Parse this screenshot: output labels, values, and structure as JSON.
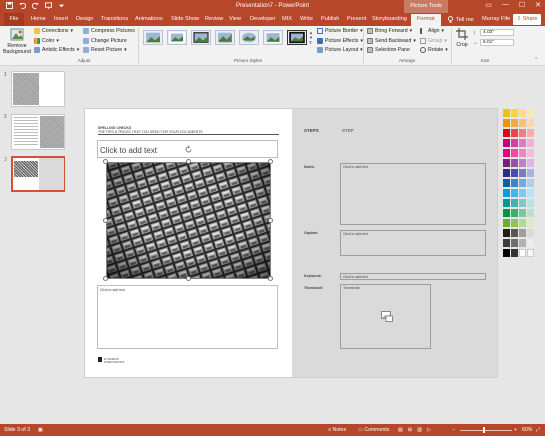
{
  "titlebar": {
    "title": "Presentation7 - PowerPoint",
    "context_tab": "Picture Tools",
    "minimize": "—",
    "maximize": "☐",
    "close": "✕"
  },
  "tabs": [
    {
      "label": "File"
    },
    {
      "label": "Home"
    },
    {
      "label": "Insert"
    },
    {
      "label": "Design"
    },
    {
      "label": "Transitions"
    },
    {
      "label": "Animations"
    },
    {
      "label": "Slide Show"
    },
    {
      "label": "Review"
    },
    {
      "label": "View"
    },
    {
      "label": "Developer"
    },
    {
      "label": "MIX"
    },
    {
      "label": "Write"
    },
    {
      "label": "Publish"
    },
    {
      "label": "Present"
    },
    {
      "label": "Storyboarding"
    },
    {
      "label": "Format"
    }
  ],
  "tellme": "Tell me",
  "user": "Murray Fife",
  "share": "Share",
  "ribbon": {
    "remove_bg": [
      "Remove",
      "Background"
    ],
    "corrections": "Corrections",
    "color": "Color",
    "artistic": "Artistic Effects",
    "compress": "Compress Pictures",
    "change": "Change Picture",
    "reset": "Reset Picture",
    "adjust_label": "Adjust",
    "styles_label": "Picture Styles",
    "border": "Picture Border",
    "effects": "Picture Effects",
    "layout": "Picture Layout",
    "bring": "Bring Forward",
    "send": "Send Backward",
    "selpane": "Selection Pane",
    "align": "Align",
    "group": "Group",
    "rotate": "Rotate",
    "arrange_label": "Arrange",
    "crop": "Crop",
    "height": "4.03\"",
    "width": "6.01\"",
    "size_label": "Size"
  },
  "thumbs": [
    {
      "num": "1"
    },
    {
      "num": "2"
    },
    {
      "num": "3"
    }
  ],
  "slide": {
    "header_line1": "SPELLING CHECKS",
    "header_line2": "THE TIPS & TRICKS THAT YOU NEED FOR YOUR DOCUMENTS",
    "title_placeholder": "Click to add text",
    "body_placeholder": "Click to add text",
    "logo_line1": "DYNAMICS",
    "logo_line2": "PUBLICATIONS",
    "steps": "STEPS",
    "step": "STEP",
    "notes_label": "Notes:",
    "notes_ph": "Click to add text",
    "caption_label": "Caption:",
    "caption_ph": "Click to add text",
    "keywords_label": "Keywords:",
    "keywords_ph": "Click to add text",
    "thumbnail_label": "Thumbnail:",
    "thumbnail_ph": "Thumbnail"
  },
  "status": {
    "slide": "Slide 3 of 3",
    "notes": "Notes",
    "comments": "Comments",
    "zoom": "60%"
  },
  "colors": {
    "brand": "#b7472a",
    "canvas": "#e6e6e6"
  }
}
